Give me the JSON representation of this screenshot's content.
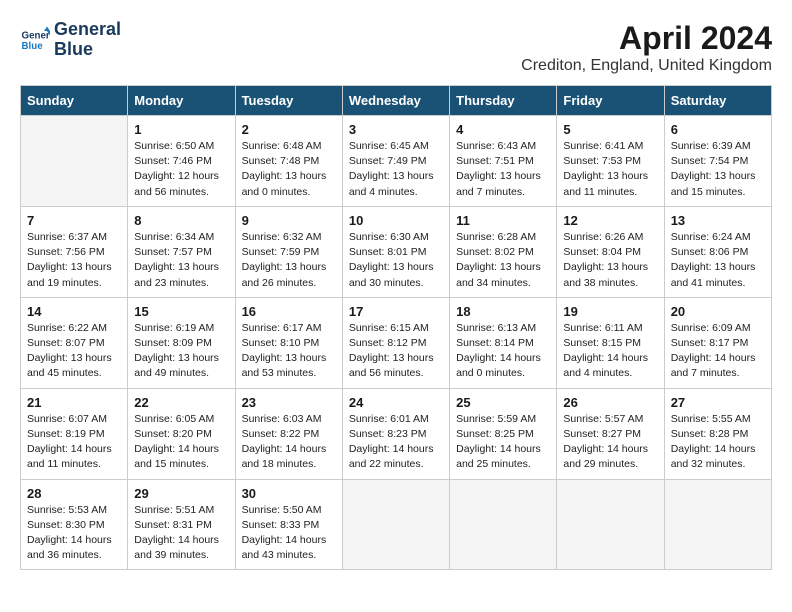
{
  "header": {
    "logo_line1": "General",
    "logo_line2": "Blue",
    "title": "April 2024",
    "subtitle": "Crediton, England, United Kingdom"
  },
  "days_of_week": [
    "Sunday",
    "Monday",
    "Tuesday",
    "Wednesday",
    "Thursday",
    "Friday",
    "Saturday"
  ],
  "weeks": [
    [
      {
        "day": "",
        "sunrise": "",
        "sunset": "",
        "daylight": "",
        "empty": true
      },
      {
        "day": "1",
        "sunrise": "Sunrise: 6:50 AM",
        "sunset": "Sunset: 7:46 PM",
        "daylight": "Daylight: 12 hours and 56 minutes."
      },
      {
        "day": "2",
        "sunrise": "Sunrise: 6:48 AM",
        "sunset": "Sunset: 7:48 PM",
        "daylight": "Daylight: 13 hours and 0 minutes."
      },
      {
        "day": "3",
        "sunrise": "Sunrise: 6:45 AM",
        "sunset": "Sunset: 7:49 PM",
        "daylight": "Daylight: 13 hours and 4 minutes."
      },
      {
        "day": "4",
        "sunrise": "Sunrise: 6:43 AM",
        "sunset": "Sunset: 7:51 PM",
        "daylight": "Daylight: 13 hours and 7 minutes."
      },
      {
        "day": "5",
        "sunrise": "Sunrise: 6:41 AM",
        "sunset": "Sunset: 7:53 PM",
        "daylight": "Daylight: 13 hours and 11 minutes."
      },
      {
        "day": "6",
        "sunrise": "Sunrise: 6:39 AM",
        "sunset": "Sunset: 7:54 PM",
        "daylight": "Daylight: 13 hours and 15 minutes."
      }
    ],
    [
      {
        "day": "7",
        "sunrise": "Sunrise: 6:37 AM",
        "sunset": "Sunset: 7:56 PM",
        "daylight": "Daylight: 13 hours and 19 minutes."
      },
      {
        "day": "8",
        "sunrise": "Sunrise: 6:34 AM",
        "sunset": "Sunset: 7:57 PM",
        "daylight": "Daylight: 13 hours and 23 minutes."
      },
      {
        "day": "9",
        "sunrise": "Sunrise: 6:32 AM",
        "sunset": "Sunset: 7:59 PM",
        "daylight": "Daylight: 13 hours and 26 minutes."
      },
      {
        "day": "10",
        "sunrise": "Sunrise: 6:30 AM",
        "sunset": "Sunset: 8:01 PM",
        "daylight": "Daylight: 13 hours and 30 minutes."
      },
      {
        "day": "11",
        "sunrise": "Sunrise: 6:28 AM",
        "sunset": "Sunset: 8:02 PM",
        "daylight": "Daylight: 13 hours and 34 minutes."
      },
      {
        "day": "12",
        "sunrise": "Sunrise: 6:26 AM",
        "sunset": "Sunset: 8:04 PM",
        "daylight": "Daylight: 13 hours and 38 minutes."
      },
      {
        "day": "13",
        "sunrise": "Sunrise: 6:24 AM",
        "sunset": "Sunset: 8:06 PM",
        "daylight": "Daylight: 13 hours and 41 minutes."
      }
    ],
    [
      {
        "day": "14",
        "sunrise": "Sunrise: 6:22 AM",
        "sunset": "Sunset: 8:07 PM",
        "daylight": "Daylight: 13 hours and 45 minutes."
      },
      {
        "day": "15",
        "sunrise": "Sunrise: 6:19 AM",
        "sunset": "Sunset: 8:09 PM",
        "daylight": "Daylight: 13 hours and 49 minutes."
      },
      {
        "day": "16",
        "sunrise": "Sunrise: 6:17 AM",
        "sunset": "Sunset: 8:10 PM",
        "daylight": "Daylight: 13 hours and 53 minutes."
      },
      {
        "day": "17",
        "sunrise": "Sunrise: 6:15 AM",
        "sunset": "Sunset: 8:12 PM",
        "daylight": "Daylight: 13 hours and 56 minutes."
      },
      {
        "day": "18",
        "sunrise": "Sunrise: 6:13 AM",
        "sunset": "Sunset: 8:14 PM",
        "daylight": "Daylight: 14 hours and 0 minutes."
      },
      {
        "day": "19",
        "sunrise": "Sunrise: 6:11 AM",
        "sunset": "Sunset: 8:15 PM",
        "daylight": "Daylight: 14 hours and 4 minutes."
      },
      {
        "day": "20",
        "sunrise": "Sunrise: 6:09 AM",
        "sunset": "Sunset: 8:17 PM",
        "daylight": "Daylight: 14 hours and 7 minutes."
      }
    ],
    [
      {
        "day": "21",
        "sunrise": "Sunrise: 6:07 AM",
        "sunset": "Sunset: 8:19 PM",
        "daylight": "Daylight: 14 hours and 11 minutes."
      },
      {
        "day": "22",
        "sunrise": "Sunrise: 6:05 AM",
        "sunset": "Sunset: 8:20 PM",
        "daylight": "Daylight: 14 hours and 15 minutes."
      },
      {
        "day": "23",
        "sunrise": "Sunrise: 6:03 AM",
        "sunset": "Sunset: 8:22 PM",
        "daylight": "Daylight: 14 hours and 18 minutes."
      },
      {
        "day": "24",
        "sunrise": "Sunrise: 6:01 AM",
        "sunset": "Sunset: 8:23 PM",
        "daylight": "Daylight: 14 hours and 22 minutes."
      },
      {
        "day": "25",
        "sunrise": "Sunrise: 5:59 AM",
        "sunset": "Sunset: 8:25 PM",
        "daylight": "Daylight: 14 hours and 25 minutes."
      },
      {
        "day": "26",
        "sunrise": "Sunrise: 5:57 AM",
        "sunset": "Sunset: 8:27 PM",
        "daylight": "Daylight: 14 hours and 29 minutes."
      },
      {
        "day": "27",
        "sunrise": "Sunrise: 5:55 AM",
        "sunset": "Sunset: 8:28 PM",
        "daylight": "Daylight: 14 hours and 32 minutes."
      }
    ],
    [
      {
        "day": "28",
        "sunrise": "Sunrise: 5:53 AM",
        "sunset": "Sunset: 8:30 PM",
        "daylight": "Daylight: 14 hours and 36 minutes."
      },
      {
        "day": "29",
        "sunrise": "Sunrise: 5:51 AM",
        "sunset": "Sunset: 8:31 PM",
        "daylight": "Daylight: 14 hours and 39 minutes."
      },
      {
        "day": "30",
        "sunrise": "Sunrise: 5:50 AM",
        "sunset": "Sunset: 8:33 PM",
        "daylight": "Daylight: 14 hours and 43 minutes."
      },
      {
        "day": "",
        "sunrise": "",
        "sunset": "",
        "daylight": "",
        "empty": true
      },
      {
        "day": "",
        "sunrise": "",
        "sunset": "",
        "daylight": "",
        "empty": true
      },
      {
        "day": "",
        "sunrise": "",
        "sunset": "",
        "daylight": "",
        "empty": true
      },
      {
        "day": "",
        "sunrise": "",
        "sunset": "",
        "daylight": "",
        "empty": true
      }
    ]
  ]
}
